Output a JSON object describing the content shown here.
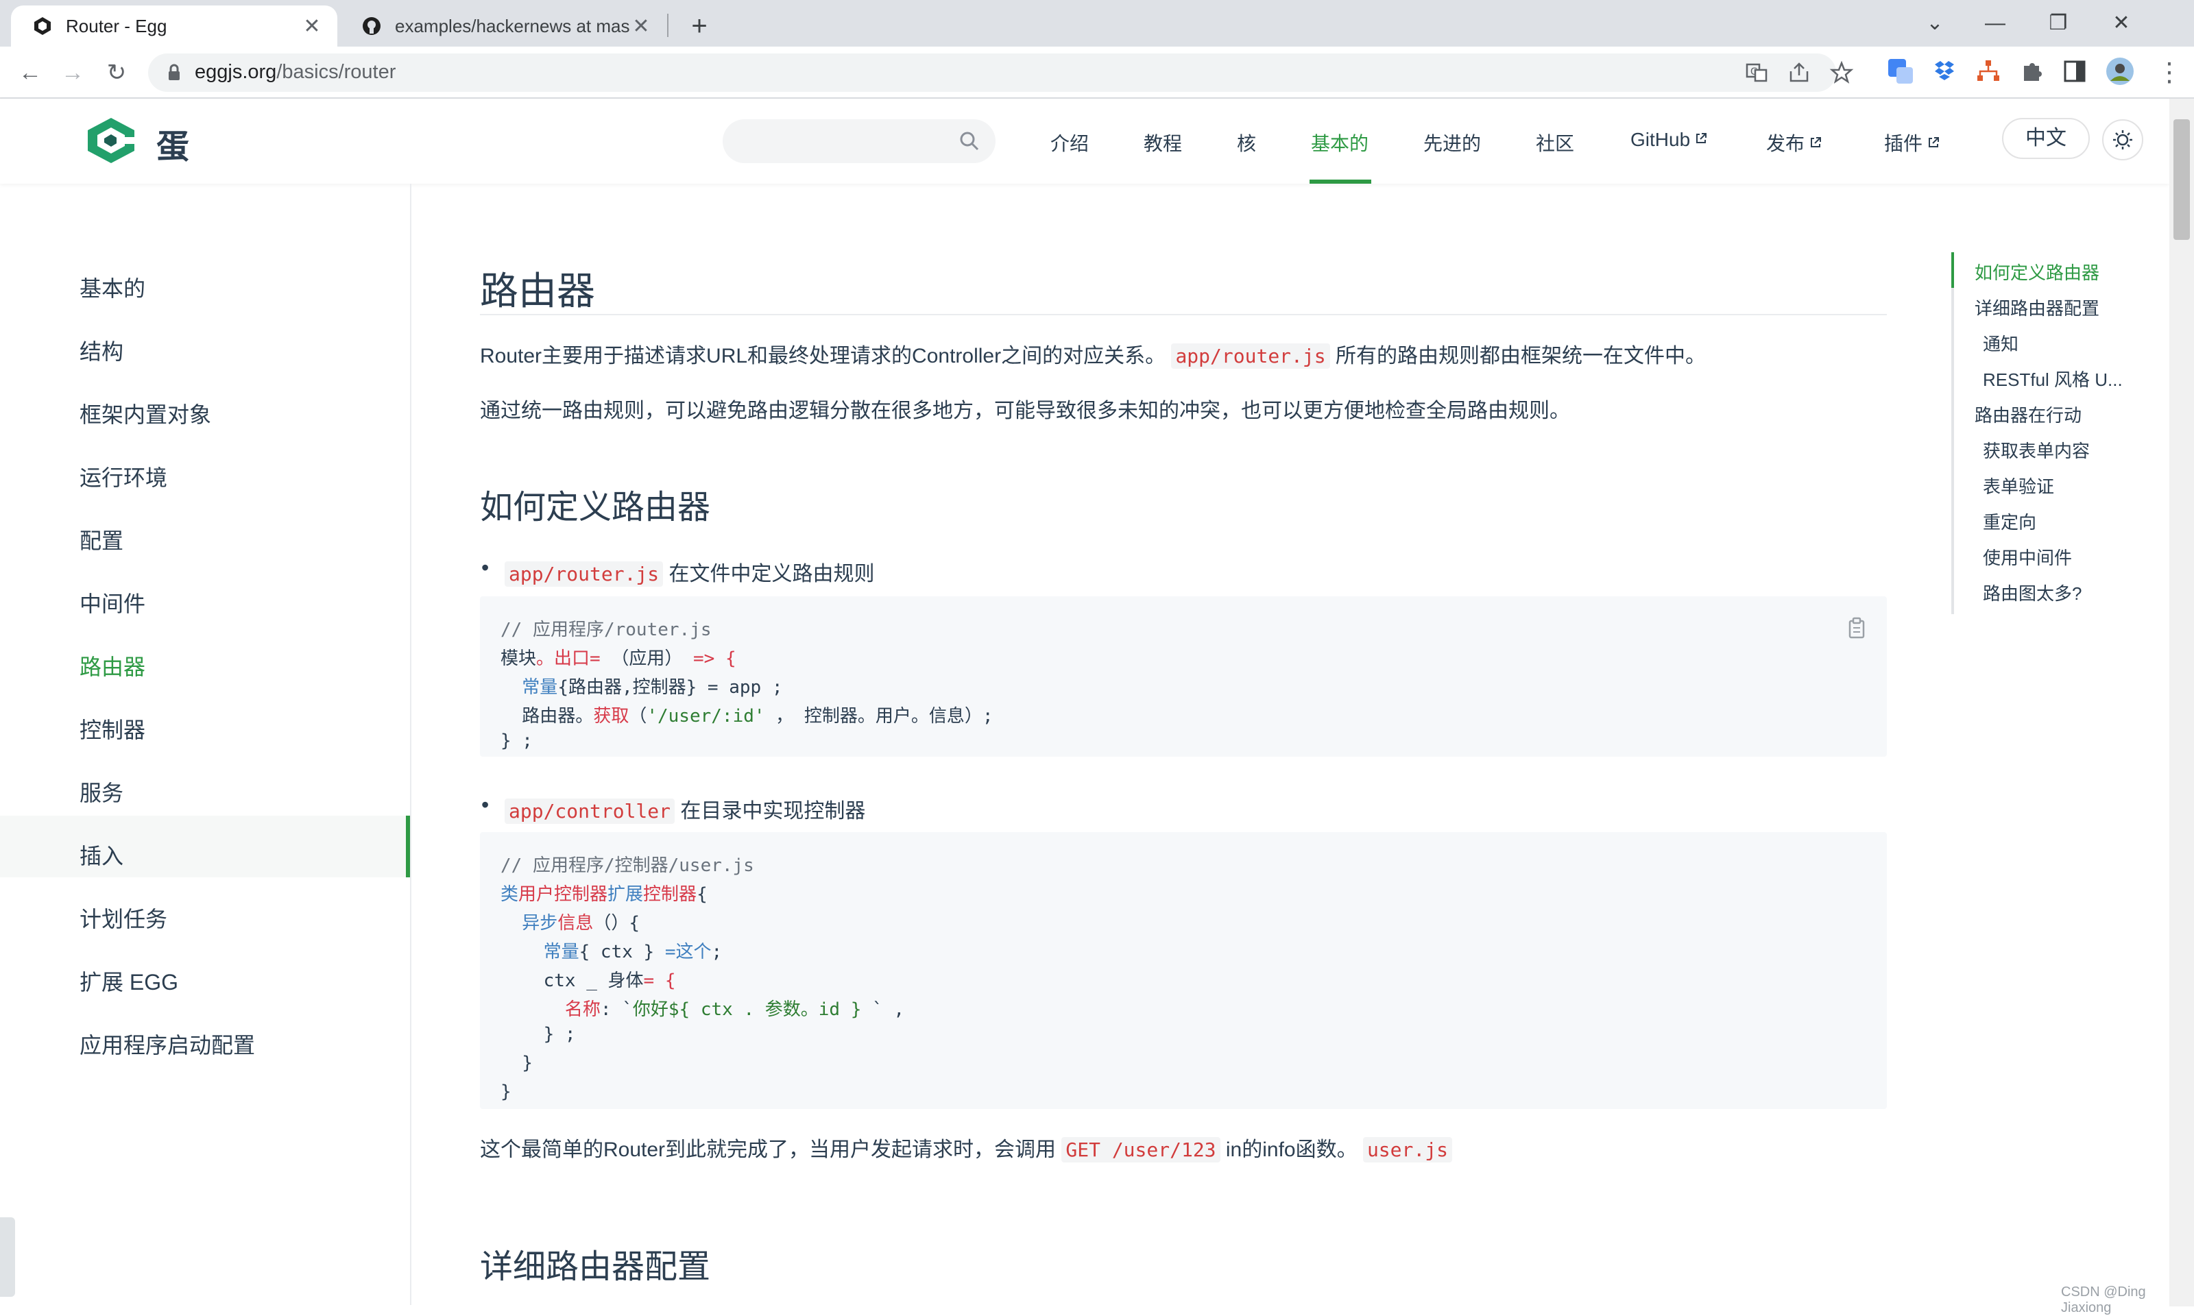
{
  "browser": {
    "tabs": [
      {
        "title": "Router - Egg",
        "active": true
      },
      {
        "title": "examples/hackernews at mast",
        "active": false
      }
    ],
    "url_host": "eggjs.org",
    "url_path": "/basics/router"
  },
  "site": {
    "brand": "蛋",
    "nav": [
      "介绍",
      "教程",
      "核",
      "基本的",
      "先进的",
      "社区",
      "GitHub",
      "发布",
      "插件"
    ],
    "active_nav": "基本的",
    "lang_button": "中文"
  },
  "sidebar": {
    "items": [
      "基本的",
      "结构",
      "框架内置对象",
      "运行环境",
      "配置",
      "中间件",
      "路由器",
      "控制器",
      "服务",
      "插入",
      "计划任务",
      "扩展 EGG",
      "应用程序启动配置"
    ],
    "active": "路由器"
  },
  "content": {
    "title": "路由器",
    "p1_before": "Router主要用于描述请求URL和最终处理请求的Controller之间的对应关系。",
    "p1_code": "app/router.js",
    "p1_after": " 所有的路由规则都由框架统一在文件中。",
    "p2": "通过统一路由规则，可以避免路由逻辑分散在很多地方，可能导致很多未知的冲突，也可以更方便地检查全局路由规则。",
    "h2_define": "如何定义路由器",
    "bullet1_code": "app/router.js",
    "bullet1_text": " 在文件中定义路由规则",
    "code1": {
      "l1": "// 应用程序/router.js",
      "l2a": "模块",
      "l2b": "。出口= ",
      "l2c": "（应用）",
      "l2d": " => {",
      "l3a": "  常量",
      "l3b": "{路由器,控制器} = app ;",
      "l4a": "  路由器。",
      "l4b": "获取",
      "l4c": "（",
      "l4d": "'/user/:id'",
      "l4e": " ， 控制器。用户。信息）;",
      "l5": "} ;"
    },
    "bullet2_code": "app/controller",
    "bullet2_text": " 在目录中实现控制器",
    "code2": {
      "l1": "// 应用程序/控制器/user.js",
      "l2a": "类",
      "l2b": "用户控制器",
      "l2c": "扩展",
      "l2d": "控制器",
      "l2e": "{",
      "l3a": "  异步",
      "l3b": "信息",
      "l3c": "（）{",
      "l4a": "    常量",
      "l4b": "{ ctx } ",
      "l4c": "=这个",
      "l4d": ";",
      "l5a": "    ctx _ 身体",
      "l5b": "= {",
      "l6a": "      名称",
      "l6b": ": `",
      "l6c": "你好${ ctx . 参数。id }",
      "l6d": " ` ,",
      "l7": "    } ;",
      "l8": "  }",
      "l9": "}"
    },
    "p3_before": "这个最简单的Router到此就完成了，当用户发起请求时，会调用 ",
    "p3_code1": "GET /user/123",
    "p3_mid": " in的info函数。",
    "p3_code2": "user.js",
    "h2_detail": "详细路由器配置"
  },
  "toc": {
    "items": [
      "如何定义路由器",
      "详细路由器配置",
      "通知",
      "RESTful 风格 U...",
      "路由器在行动",
      "获取表单内容",
      "表单验证",
      "重定向",
      "使用中间件",
      "路由图太多?"
    ],
    "active": "如何定义路由器"
  },
  "watermark": "CSDN @Ding Jiaxiong",
  "colors": {
    "accent": "#2e9a44",
    "code_red": "#d23c3c",
    "text": "#2c3e50"
  }
}
